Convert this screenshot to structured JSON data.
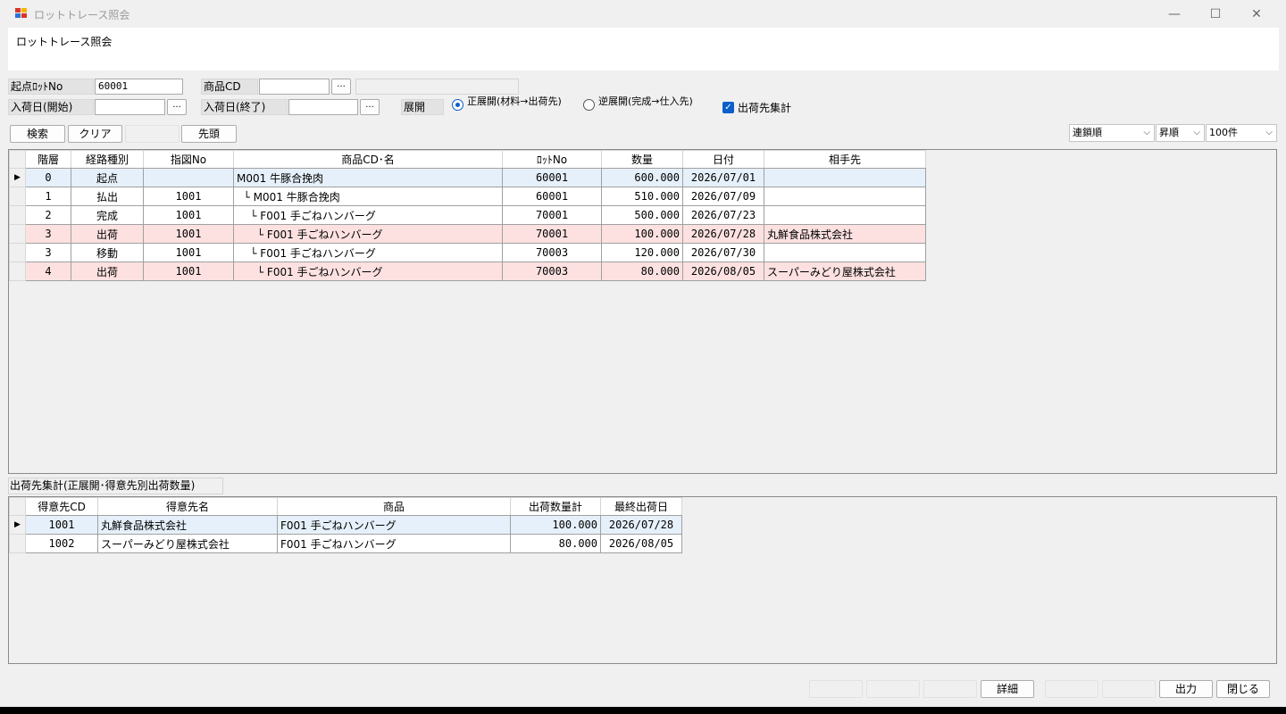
{
  "window": {
    "title": "ロットトレース照会",
    "minimize_glyph": "—",
    "maximize_glyph": "☐",
    "close_glyph": "✕"
  },
  "header": {
    "title": "ロットトレース照会"
  },
  "form": {
    "start_lot_label": "起点ﾛｯﾄNo",
    "start_lot_value": "60001",
    "product_cd_label": "商品CD",
    "product_cd_value": "",
    "product_name_value": "",
    "arrival_start_label": "入荷日(開始)",
    "arrival_start_value": "",
    "arrival_end_label": "入荷日(終了)",
    "arrival_end_value": "",
    "ellipsis": "...",
    "expand_label": "展開",
    "radio_forward": "正展開(材料→出荷先)",
    "radio_reverse": "逆展開(完成→仕入先)",
    "ship_total_check": "出荷先集計",
    "check_mark": "✓"
  },
  "toolbar": {
    "search_button": "検索",
    "clear_button": "クリア",
    "top_button": "先頭",
    "sort_key": "連鎖順",
    "sort_order": "昇順",
    "page_size": "100件",
    "chevron": "⌵"
  },
  "trace_grid": {
    "columns": [
      "階層",
      "経路種別",
      "指図No",
      "商品CD･名",
      "ﾛｯﾄNo",
      "数量",
      "日付",
      "相手先"
    ],
    "rows": [
      {
        "level": "0",
        "route": "起点",
        "order": "",
        "product": "M001 牛豚合挽肉",
        "lot": "60001",
        "qty": "600.000",
        "date": "2026/07/01",
        "partner": "",
        "state": "selected"
      },
      {
        "level": "1",
        "route": "払出",
        "order": "1001",
        "product": "  └ M001 牛豚合挽肉",
        "lot": "60001",
        "qty": "510.000",
        "date": "2026/07/09",
        "partner": "",
        "state": "normal"
      },
      {
        "level": "2",
        "route": "完成",
        "order": "1001",
        "product": "    └ F001 手ごねハンバーグ",
        "lot": "70001",
        "qty": "500.000",
        "date": "2026/07/23",
        "partner": "",
        "state": "normal"
      },
      {
        "level": "3",
        "route": "出荷",
        "order": "1001",
        "product": "      └ F001 手ごねハンバーグ",
        "lot": "70001",
        "qty": "100.000",
        "date": "2026/07/28",
        "partner": "丸鮮食品株式会社",
        "state": "pink"
      },
      {
        "level": "3",
        "route": "移動",
        "order": "1001",
        "product": "    └ F001 手ごねハンバーグ",
        "lot": "70003",
        "qty": "120.000",
        "date": "2026/07/30",
        "partner": "",
        "state": "normal"
      },
      {
        "level": "4",
        "route": "出荷",
        "order": "1001",
        "product": "      └ F001 手ごねハンバーグ",
        "lot": "70003",
        "qty": "80.000",
        "date": "2026/08/05",
        "partner": "スーパーみどり屋株式会社",
        "state": "pink"
      }
    ]
  },
  "summary": {
    "label": "出荷先集計(正展開･得意先別出荷数量)",
    "columns": [
      "得意先CD",
      "得意先名",
      "商品",
      "出荷数量計",
      "最終出荷日"
    ],
    "rows": [
      {
        "cd": "1001",
        "name": "丸鮮食品株式会社",
        "product": "F001 手ごねハンバーグ",
        "qty": "100.000",
        "last": "2026/07/28",
        "state": "selected"
      },
      {
        "cd": "1002",
        "name": "スーパーみどり屋株式会社",
        "product": "F001 手ごねハンバーグ",
        "qty": "80.000",
        "last": "2026/08/05",
        "state": "normal"
      }
    ]
  },
  "footer": {
    "detail_button": "詳細",
    "output_button": "出力",
    "close_button": "閉じる"
  },
  "colors": {
    "selected_row": "#e6f0fa",
    "shipment_row": "#fde1e1",
    "accent": "#0b5fc9"
  }
}
